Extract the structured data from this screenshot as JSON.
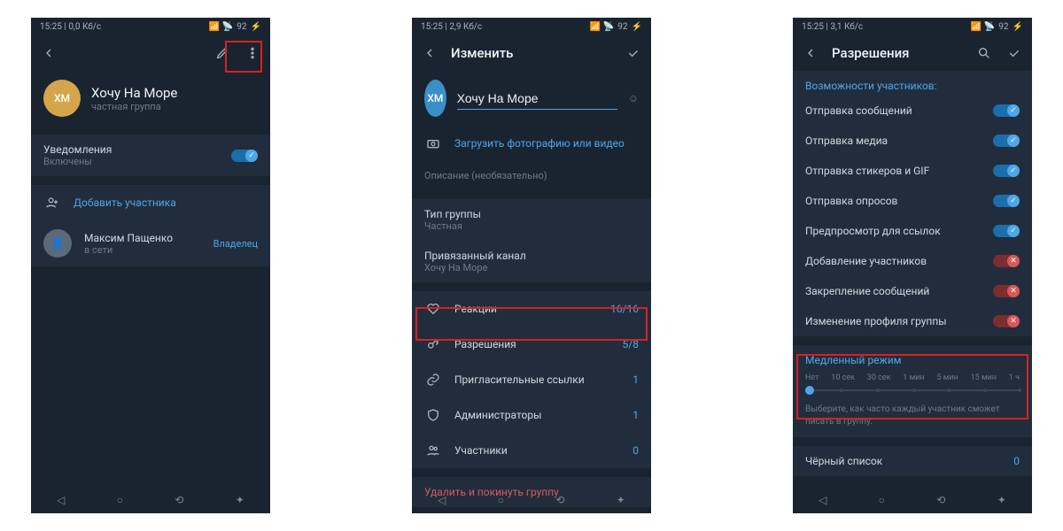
{
  "status": {
    "time": "15:25",
    "kb1": "0,0 Кб/с",
    "kb2": "2,9 Кб/с",
    "kb3": "3,1 Кб/с",
    "battery": "92"
  },
  "s1": {
    "group_name": "Хочу На Море",
    "group_type": "частная группа",
    "avatar_text": "ХМ",
    "avatar_color": "#d4a54a",
    "notif_label": "Уведомления",
    "notif_sub": "Включены",
    "add_member": "Добавить участника",
    "member_name": "Максим Пащенко",
    "member_status": "в сети",
    "member_role": "Владелец"
  },
  "s2": {
    "title": "Изменить",
    "avatar_text": "ХМ",
    "avatar_color": "#3a8fc9",
    "name_value": "Хочу На Море",
    "upload": "Загрузить фотографию или видео",
    "desc_ph": "Описание (необязательно)",
    "grp_type_label": "Тип группы",
    "grp_type_val": "Частная",
    "linked_label": "Привязанный канал",
    "linked_val": "Хочу На Море",
    "reactions": "Реакции",
    "reactions_val": "16/16",
    "perms": "Разрешения",
    "perms_val": "5/8",
    "invites": "Пригласительные ссылки",
    "invites_val": "1",
    "admins": "Администраторы",
    "admins_val": "1",
    "members": "Участники",
    "members_val": "0",
    "delete": "Удалить и покинуть группу"
  },
  "s3": {
    "title": "Разрешения",
    "caps_header": "Возможности участников:",
    "p1": "Отправка сообщений",
    "p2": "Отправка медиа",
    "p3": "Отправка стикеров и GIF",
    "p4": "Отправка опросов",
    "p5": "Предпросмотр для ссылок",
    "p6": "Добавление участников",
    "p7": "Закрепление сообщений",
    "p8": "Изменение профиля группы",
    "slow_header": "Медленный режим",
    "sl": [
      "Нет",
      "10 сек",
      "30 сек",
      "1 мин",
      "5 мин",
      "15 мин",
      "1 ч"
    ],
    "slow_hint": "Выберите, как часто каждый участник сможет писать в группу.",
    "blacklist": "Чёрный список",
    "blacklist_val": "0"
  }
}
